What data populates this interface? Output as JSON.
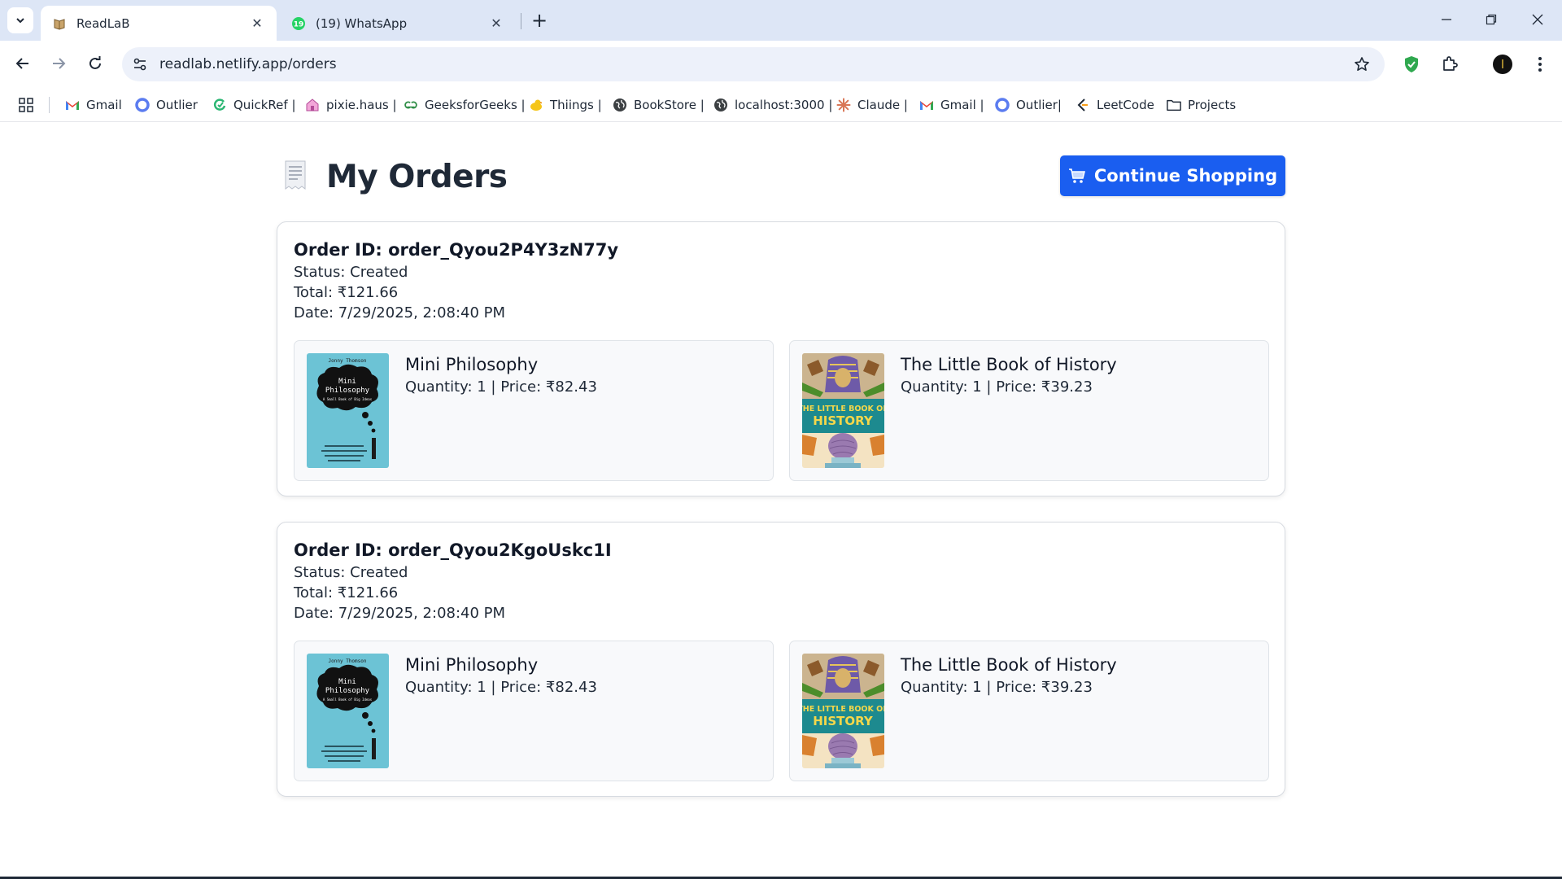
{
  "browser": {
    "tabs": [
      {
        "title": "ReadLaB",
        "active": true
      },
      {
        "title": "(19) WhatsApp",
        "active": false,
        "badge": "19"
      }
    ],
    "url": "readlab.netlify.app/orders",
    "bookmarks": [
      {
        "label": "Gmail",
        "icon": "gmail-icon"
      },
      {
        "label": "Outlier",
        "icon": "outlier-icon"
      },
      {
        "label": "QuickRef |",
        "icon": "quickref-icon"
      },
      {
        "label": "pixie.haus |",
        "icon": "pixie-icon"
      },
      {
        "label": "GeeksforGeeks |",
        "icon": "gfg-icon"
      },
      {
        "label": "Thiings |",
        "icon": "thiings-icon"
      },
      {
        "label": "BookStore |",
        "icon": "globe-icon"
      },
      {
        "label": "localhost:3000 |",
        "icon": "globe-icon"
      },
      {
        "label": "Claude |",
        "icon": "claude-icon"
      },
      {
        "label": "Gmail |",
        "icon": "gmail-icon"
      },
      {
        "label": "Outlier|",
        "icon": "outlier-icon"
      },
      {
        "label": "LeetCode",
        "icon": "leetcode-icon"
      },
      {
        "label": "Projects",
        "icon": "folder-icon"
      }
    ]
  },
  "page": {
    "title": "My Orders",
    "continue_label": "Continue Shopping",
    "accent": "#1a5ef0"
  },
  "orders": [
    {
      "id_label": "Order ID: order_Qyou2P4Y3zN77y",
      "status_label": "Status: Created",
      "total_label": "Total: ₹121.66",
      "date_label": "Date: 7/29/2025, 2:08:40 PM",
      "items": [
        {
          "name": "Mini Philosophy",
          "meta": "Quantity: 1 | Price: ₹82.43",
          "cover": {
            "author": "Jonny Thomson",
            "title_lines": [
              "Mini",
              "Philosophy"
            ],
            "subtitle": "A Small Book of Big Ideas"
          }
        },
        {
          "name": "The Little Book of History",
          "meta": "Quantity: 1 | Price: ₹39.23",
          "cover": {
            "title_lines": [
              "THE LITTLE BOOK OF",
              "HISTORY"
            ]
          }
        }
      ]
    },
    {
      "id_label": "Order ID: order_Qyou2KgoUskc1I",
      "status_label": "Status: Created",
      "total_label": "Total: ₹121.66",
      "date_label": "Date: 7/29/2025, 2:08:40 PM",
      "items": [
        {
          "name": "Mini Philosophy",
          "meta": "Quantity: 1 | Price: ₹82.43",
          "cover": {
            "author": "Jonny Thomson",
            "title_lines": [
              "Mini",
              "Philosophy"
            ],
            "subtitle": "A Small Book of Big Ideas"
          }
        },
        {
          "name": "The Little Book of History",
          "meta": "Quantity: 1 | Price: ₹39.23",
          "cover": {
            "title_lines": [
              "THE LITTLE BOOK OF",
              "HISTORY"
            ]
          }
        }
      ]
    }
  ]
}
